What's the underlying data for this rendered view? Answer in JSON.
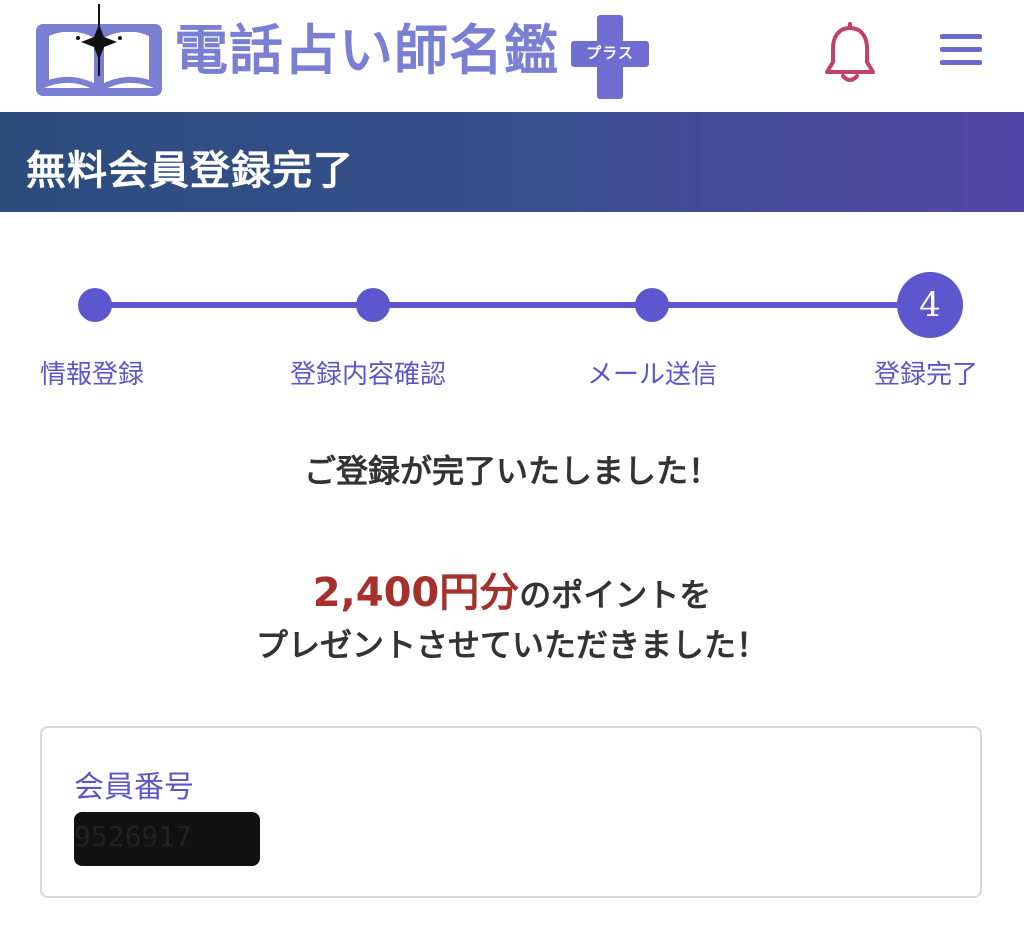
{
  "header": {
    "logo_text": "電話占い師名鑑",
    "plus_badge": "プラス",
    "bell_icon": "bell-icon",
    "menu_icon": "hamburger-menu-icon"
  },
  "page_title": "無料会員登録完了",
  "steps": {
    "items": [
      {
        "label": "情報登録"
      },
      {
        "label": "登録内容確認"
      },
      {
        "label": "メール送信"
      },
      {
        "label": "登録完了"
      }
    ],
    "current_number": "4"
  },
  "messages": {
    "completed": "ご登録が完了いたしました！",
    "points_amount": "2,400円分",
    "points_suffix": "のポイントを",
    "present": "プレゼントさせていただきました！"
  },
  "member": {
    "label": "会員番号",
    "number": "9526917"
  },
  "colors": {
    "accent": "#5d57cf",
    "title_band_start": "#2c4c7c",
    "title_band_end": "#5546a6",
    "highlight": "#a6302b",
    "bell": "#c2406a"
  }
}
